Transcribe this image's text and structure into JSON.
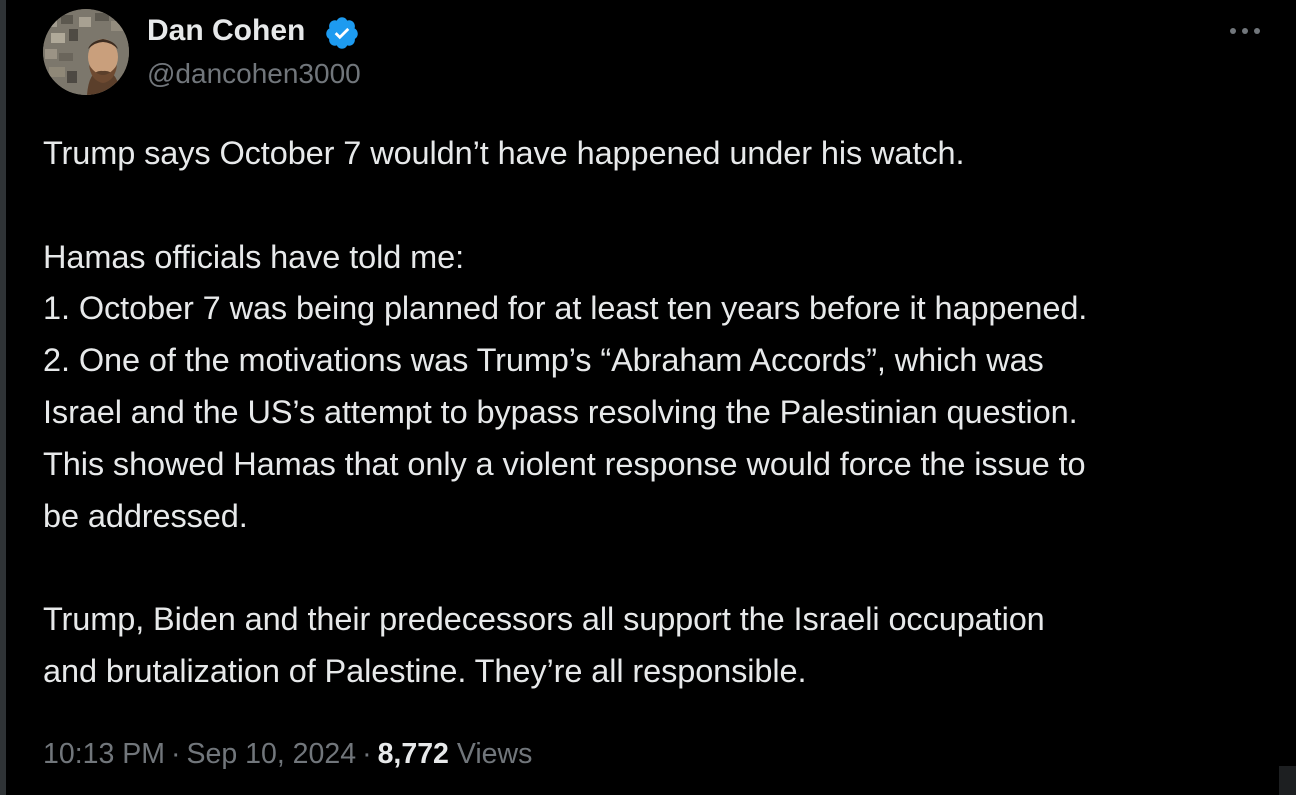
{
  "author": {
    "display_name": "Dan Cohen",
    "handle": "@dancohen3000",
    "verified": true,
    "avatar_icon": "profile-photo"
  },
  "tweet": {
    "lines": [
      "Trump says October 7 wouldn’t have happened under his watch.",
      "",
      "Hamas officials have told me:",
      "1. October 7 was being planned for at least ten years before it happened.",
      "2. One of the motivations was Trump’s “Abraham Accords”, which was",
      "Israel and the US’s attempt to bypass resolving the Palestinian question.",
      "This showed Hamas that only a violent response would force the issue to",
      "be addressed.",
      "",
      "Trump, Biden and their predecessors all support the Israeli occupation",
      "and brutalization of Palestine. They’re all responsible."
    ]
  },
  "meta": {
    "time": "10:13 PM",
    "separator": "·",
    "date": "Sep 10, 2024",
    "views_count": "8,772",
    "views_label": "Views"
  },
  "colors": {
    "background": "#000000",
    "text_primary": "#e7e9ea",
    "text_secondary": "#71767b",
    "verified_badge": "#1d9bf0"
  },
  "icons": {
    "verified": "verified-badge-icon",
    "more": "more-options-icon"
  }
}
